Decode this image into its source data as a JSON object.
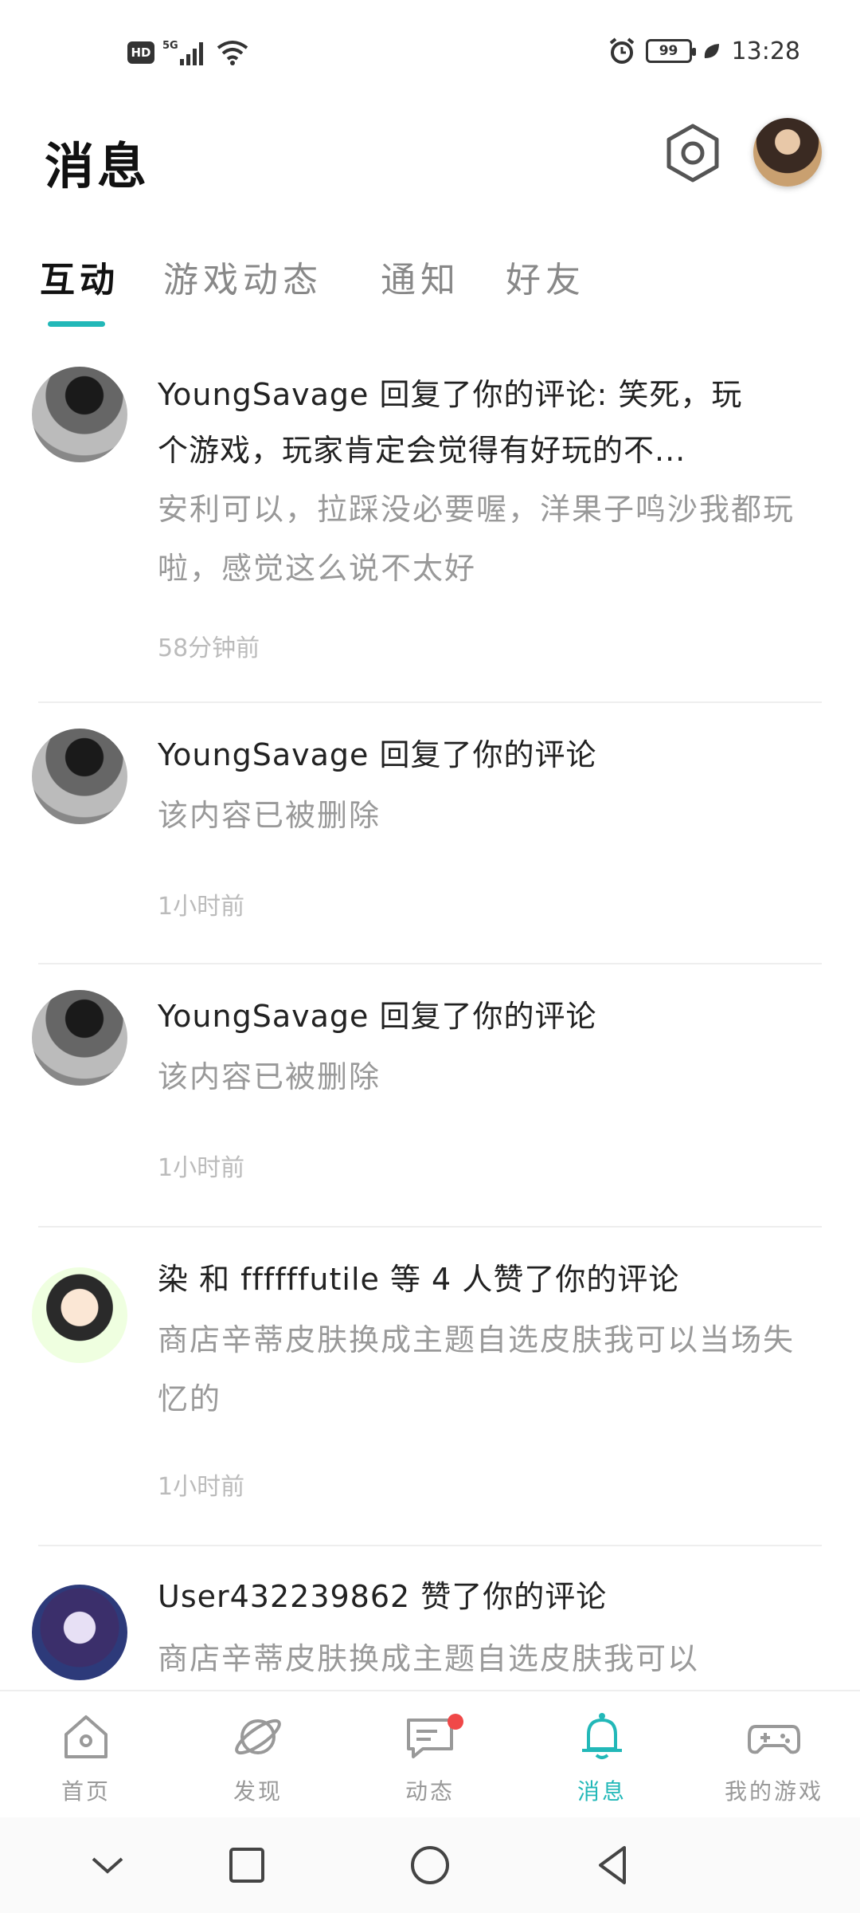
{
  "status_bar": {
    "hd": "HD",
    "network": "5G",
    "battery": "99",
    "time": "13:28"
  },
  "header": {
    "title": "消息"
  },
  "tabs": [
    {
      "label": "互动",
      "active": true
    },
    {
      "label": "游戏动态",
      "active": false
    },
    {
      "label": "通知",
      "active": false
    },
    {
      "label": "好友",
      "active": false
    }
  ],
  "messages": [
    {
      "title": "YoungSavage 回复了你的评论: 笑死，玩",
      "title_line2": "个游戏，玩家肯定会觉得有好玩的不...",
      "content": "安利可以，拉踩没必要喔，洋果子鸣沙我都玩啦，感觉这么说不太好",
      "time": "58分钟前"
    },
    {
      "title": "YoungSavage 回复了你的评论",
      "content": "该内容已被删除",
      "time": "1小时前"
    },
    {
      "title": "YoungSavage 回复了你的评论",
      "content": "该内容已被删除",
      "time": "1小时前"
    },
    {
      "title": "染 和 ffffffutile 等 4 人赞了你的评论",
      "content": "商店辛蒂皮肤换成主题自选皮肤我可以当场失忆的",
      "time": "1小时前"
    },
    {
      "title": "User432239862 赞了你的评论",
      "content": "商店辛蒂皮肤换成主题自选皮肤我可以"
    }
  ],
  "bottom_nav": [
    {
      "label": "首页",
      "icon": "home-icon"
    },
    {
      "label": "发现",
      "icon": "planet-icon"
    },
    {
      "label": "动态",
      "icon": "chat-icon"
    },
    {
      "label": "消息",
      "icon": "bell-icon",
      "active": true
    },
    {
      "label": "我的游戏",
      "icon": "gamepad-icon"
    }
  ],
  "colors": {
    "accent": "#22b8b8",
    "badge": "#f04848"
  }
}
